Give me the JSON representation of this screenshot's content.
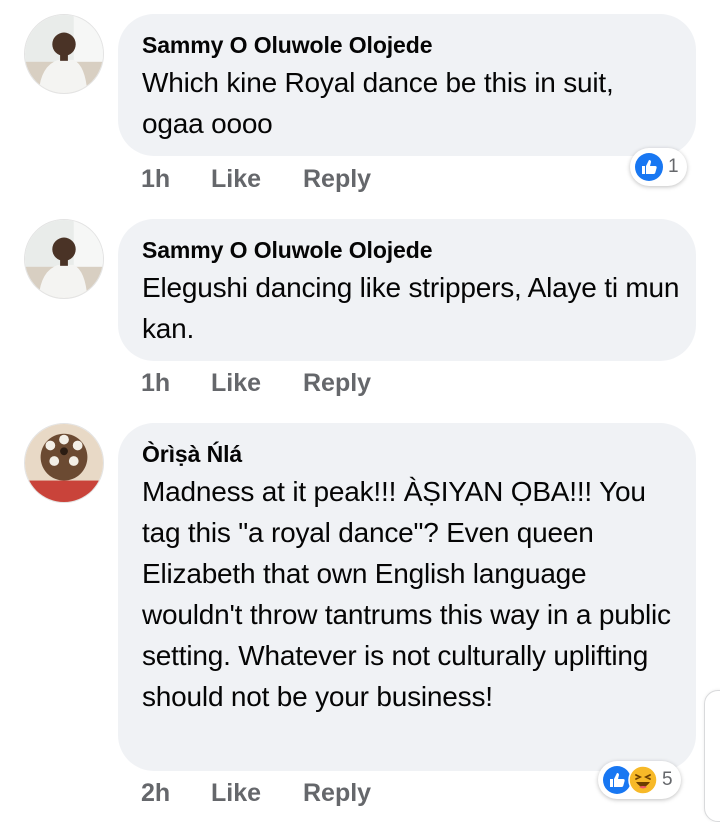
{
  "comments": [
    {
      "author": "Sammy O Oluwole Olojede",
      "text": "Which kine Royal dance be this in suit, ogaa oooo",
      "time": "1h",
      "like_label": "Like",
      "reply_label": "Reply",
      "reactions": {
        "icons": [
          "like-icon"
        ],
        "count": "1"
      }
    },
    {
      "author": "Sammy O Oluwole Olojede",
      "text": "Elegushi dancing like strippers, Alaye ti mun kan.",
      "time": "1h",
      "like_label": "Like",
      "reply_label": "Reply"
    },
    {
      "author": "Òrìṣà Ńlá",
      "text": "Madness at it peak!!! ÀṢIYAN ỌBA!!! You tag this \"a royal dance\"? Even queen Elizabeth that own English language wouldn't throw tantrums this way in a public setting. Whatever is not culturally uplifting should not be your business!",
      "time": "2h",
      "like_label": "Like",
      "reply_label": "Reply",
      "reactions": {
        "icons": [
          "like-icon",
          "haha-icon"
        ],
        "count": "5"
      }
    }
  ],
  "colors": {
    "bubble": "#f0f2f5",
    "meta_text": "#65676b",
    "like_blue": "#1877f2",
    "haha_yellow": "#f7b928"
  }
}
